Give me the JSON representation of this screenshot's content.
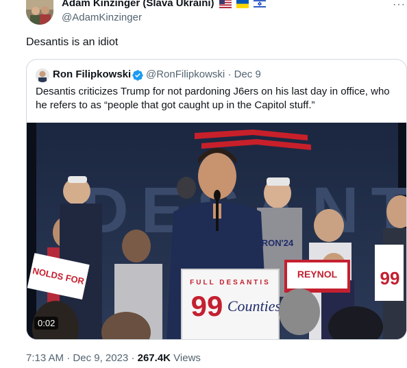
{
  "author": {
    "name": "Adam Kinzinger (Slava Ukraini)",
    "flags": [
      "us-flag-icon",
      "ukraine-flag-icon",
      "israel-flag-icon"
    ],
    "handle": "@AdamKinzinger"
  },
  "tweet": {
    "text": "Desantis is an idiot"
  },
  "quoted": {
    "name": "Ron Filipkowski",
    "handle": "@RonFilipkowski",
    "separator": "·",
    "date": "Dec 9",
    "text": "Desantis criticizes Trump for not pardoning J6ers on his last day in office, who he refers to as “people that got caught up in the Capitol stuff.”",
    "video": {
      "duration": "0:02",
      "sign_top": "FULL DESANTIS",
      "sign_number": "99",
      "sign_word": "Counties",
      "left_sign": "NOLDS FOR",
      "right_sign": "REYNOL",
      "right_sign_num": "99",
      "backdrop_text": "DESANTIS",
      "shirt_text": "RON'24"
    }
  },
  "meta": {
    "time": "7:13 AM",
    "separator": "·",
    "date": "Dec 9, 2023",
    "separator2": "·",
    "views_count": "267.4K",
    "views_label": "Views"
  },
  "colors": {
    "text": "#0f1419",
    "secondary": "#536471",
    "verified": "#1d9bf0",
    "border": "#cfd9de"
  }
}
